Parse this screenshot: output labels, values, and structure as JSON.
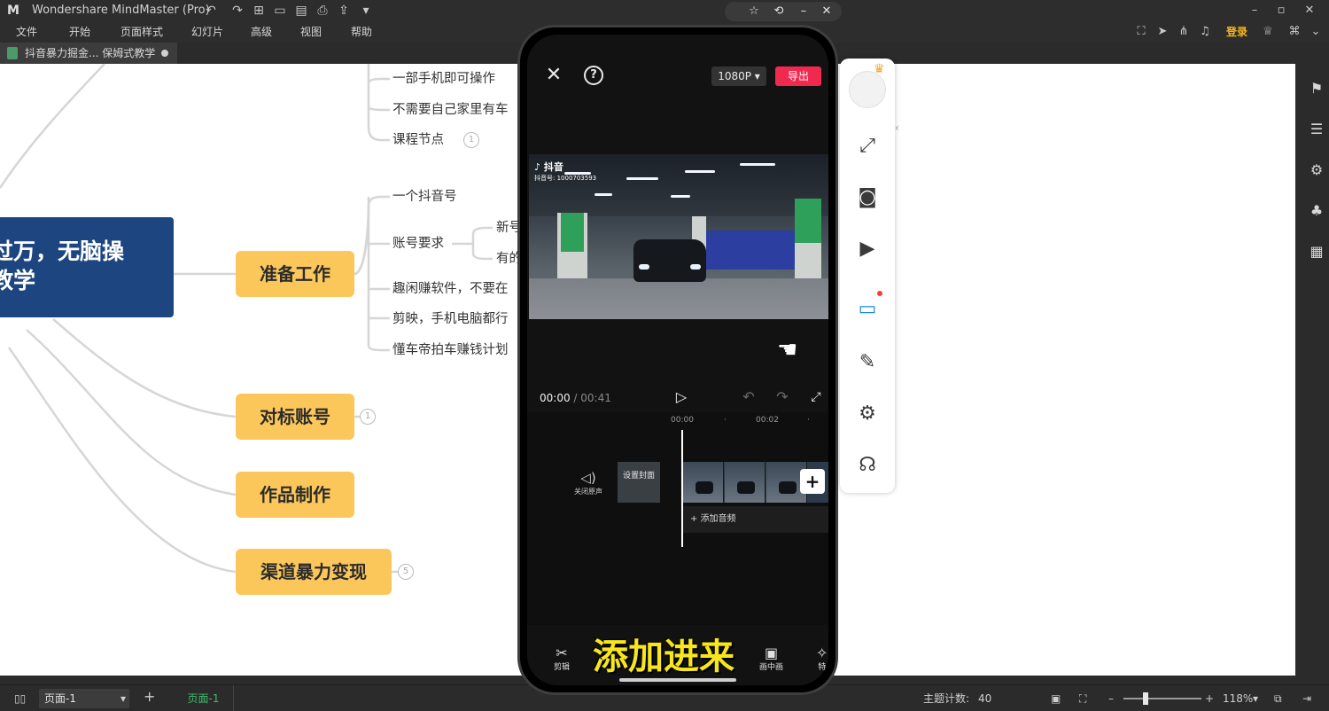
{
  "app": {
    "logo_glyph": "M",
    "title": "Wondershare MindMaster (Pro)",
    "quick_access": [
      "↶",
      "↷",
      "⊞",
      "▭",
      "▤",
      "⎙",
      "⇪",
      "▾"
    ],
    "window_controls": [
      "–",
      "▫",
      "✕"
    ]
  },
  "menubar": {
    "items": [
      "文件",
      "开始",
      "页面样式",
      "幻灯片",
      "高级",
      "视图",
      "帮助"
    ],
    "login_label": "登录"
  },
  "tab": {
    "title": "抖音暴力掘金... 保姆式教学"
  },
  "mindmap": {
    "root_lines": [
      "过万，无脑操",
      "教学"
    ],
    "branches": [
      "准备工作",
      "对标账号",
      "作品制作",
      "渠道暴力变现"
    ],
    "leaves_top": [
      "一部手机即可操作",
      "不需要自己家里有车",
      "课程节点"
    ],
    "leaves_prep": [
      "一个抖音号",
      "账号要求",
      "趣闲赚软件，不要在",
      "剪映，手机电脑都行",
      "懂车帝拍车赚钱计划"
    ],
    "sub_leaves": [
      "新号",
      "有的"
    ],
    "badges": [
      "1",
      "1",
      "5"
    ]
  },
  "floating_toolbar": [
    "☆",
    "⟲",
    "–",
    "✕"
  ],
  "phone": {
    "close_icon": "✕",
    "help_icon": "?",
    "resolution": "1080P ▾",
    "export_label": "导出",
    "watermark_logo": "♪ 抖音",
    "watermark_id": "抖音号: 1000703593",
    "time_current": "00:00",
    "time_total": "/ 00:41",
    "ruler": [
      "00:00",
      "·",
      "00:02",
      "·"
    ],
    "mute_label": "关闭原声",
    "cover_label": "设置封面",
    "add_clip": "+",
    "add_audio": "+  添加音频",
    "bottom_tools": [
      {
        "icon": "✂",
        "label": "剪辑"
      },
      {
        "icon": "▣",
        "label": "画中画"
      },
      {
        "icon": "✧",
        "label": "特"
      }
    ],
    "caption": "添加进来"
  },
  "recorder_panel": {
    "crown": "♛",
    "collapse": "‹",
    "tools": [
      "⤢",
      "◙",
      "▶",
      "▭",
      "✎",
      "⚙",
      "☊"
    ],
    "active_index": 3
  },
  "right_panel_icons": [
    "⚑",
    "☰",
    "⚙",
    "♣",
    "▦"
  ],
  "statusbar": {
    "page_select": "页面-1",
    "add_page": "+",
    "page_tab": "页面-1",
    "topic_count_label": "主题计数:",
    "topic_count": "40",
    "zoom": "118%",
    "zoom_minus": "–",
    "zoom_plus": "+"
  }
}
